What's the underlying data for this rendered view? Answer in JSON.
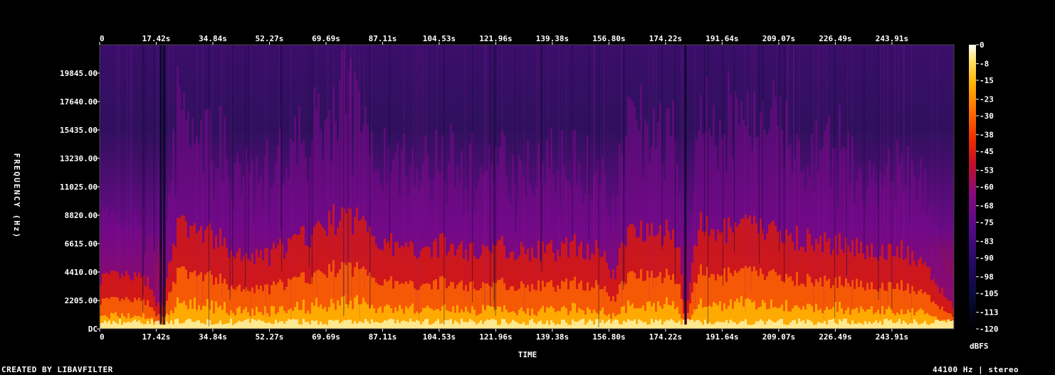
{
  "chart_data": {
    "type": "heatmap",
    "title": "",
    "xlabel": "TIME",
    "ylabel": "FREQUENCY (Hz)",
    "x_ticks": [
      "0",
      "17.42s",
      "34.84s",
      "52.27s",
      "69.69s",
      "87.11s",
      "104.53s",
      "121.96s",
      "139.38s",
      "156.80s",
      "174.22s",
      "191.64s",
      "209.07s",
      "226.49s",
      "243.91s"
    ],
    "x_tick_values": [
      0,
      17.42,
      34.84,
      52.27,
      69.69,
      87.11,
      104.53,
      121.96,
      139.38,
      156.8,
      174.22,
      191.64,
      209.07,
      226.49,
      243.91
    ],
    "xlim": [
      0,
      263
    ],
    "y_ticks": [
      "DC",
      "2205.00",
      "4410.00",
      "6615.00",
      "8820.00",
      "11025.00",
      "13230.00",
      "15435.00",
      "17640.00",
      "19845.00"
    ],
    "y_tick_values": [
      0,
      2205,
      4410,
      6615,
      8820,
      11025,
      13230,
      15435,
      17640,
      19845
    ],
    "ylim": [
      0,
      22050
    ],
    "colorbar": {
      "label": "dBFS",
      "ticks": [
        "0",
        "-8",
        "-15",
        "-23",
        "-30",
        "-38",
        "-45",
        "-53",
        "-60",
        "-68",
        "-75",
        "-83",
        "-90",
        "-98",
        "-105",
        "-113",
        "-120"
      ],
      "tick_values": [
        0,
        -8,
        -15,
        -23,
        -30,
        -38,
        -45,
        -53,
        -60,
        -68,
        -75,
        -83,
        -90,
        -98,
        -105,
        -113,
        -120
      ],
      "range": [
        -120,
        0
      ]
    },
    "energy_profile": {
      "time_s": [
        0,
        8,
        14,
        17,
        19,
        21,
        24,
        30,
        36,
        42,
        50,
        58,
        66,
        72,
        80,
        86,
        93,
        100,
        106,
        114,
        122,
        130,
        138,
        146,
        154,
        158,
        162,
        168,
        174,
        178,
        180,
        184,
        192,
        200,
        208,
        216,
        224,
        232,
        240,
        248,
        256,
        263
      ],
      "high_energy_cutoff_hz": [
        4000,
        4000,
        3800,
        2000,
        1800,
        5500,
        8000,
        7500,
        7000,
        5500,
        5500,
        6500,
        7500,
        8500,
        8500,
        7000,
        6000,
        6500,
        6500,
        6000,
        6500,
        6000,
        6000,
        6500,
        6000,
        4000,
        7500,
        8000,
        7500,
        7000,
        500,
        8000,
        7500,
        8000,
        7500,
        7000,
        6500,
        6500,
        6000,
        6000,
        4000,
        1500
      ]
    }
  },
  "footer": {
    "left": "CREATED BY LIBAVFILTER",
    "right": "44100 Hz | stereo"
  },
  "colors": {
    "background": "#000000",
    "palette": [
      "#000000",
      "#0a0a3a",
      "#2a0a6a",
      "#5a0a8a",
      "#8a0a7a",
      "#c0102a",
      "#e82a00",
      "#ff6a00",
      "#ffb000",
      "#ffe060",
      "#ffffff"
    ]
  }
}
